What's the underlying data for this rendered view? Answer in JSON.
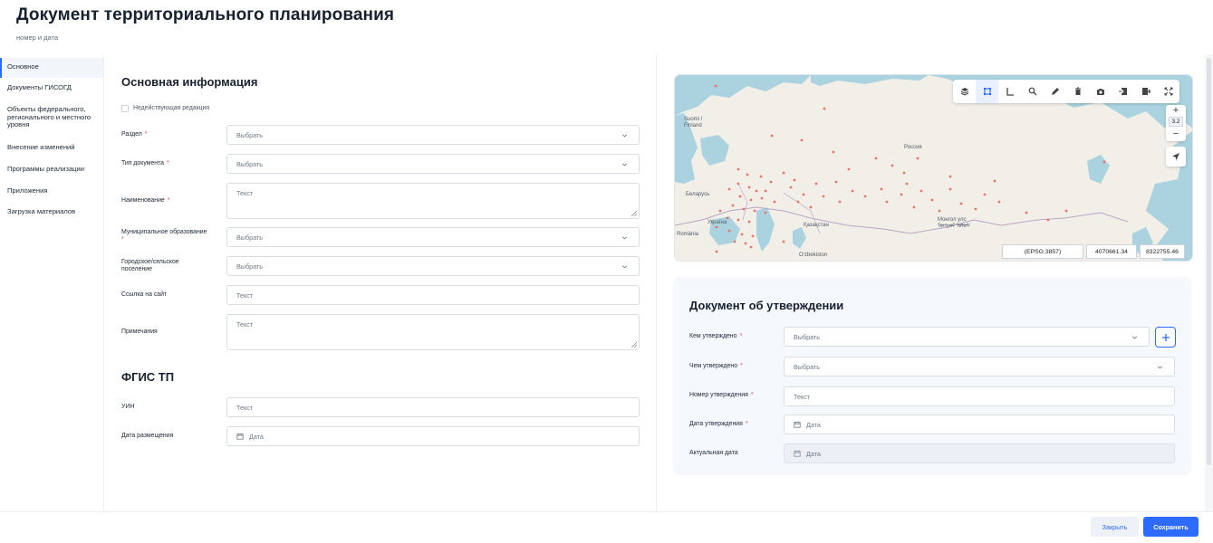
{
  "header": {
    "title": "Документ территориального планирования",
    "subtitle": "номер и дата"
  },
  "sidebar": {
    "items": [
      {
        "label": "Основное",
        "active": true
      },
      {
        "label": "Документы ГИСОГД",
        "active": false
      },
      {
        "label": "Объекты федерального, регионального и местного уровня",
        "active": false
      },
      {
        "label": "Внесение изменений",
        "active": false
      },
      {
        "label": "Программы реализации",
        "active": false
      },
      {
        "label": "Приложения",
        "active": false
      },
      {
        "label": "Загрузка материалов",
        "active": false
      }
    ]
  },
  "main_info": {
    "title": "Основная информация",
    "inactive_checkbox_label": "Недействующая редакция",
    "fields": {
      "section": {
        "label": "Раздел",
        "placeholder": "Выбрать"
      },
      "doc_type": {
        "label": "Тип документа",
        "placeholder": "Выбрать"
      },
      "name": {
        "label": "Наименование",
        "placeholder": "Текст"
      },
      "municipality": {
        "label": "Муниципальное образование",
        "placeholder": "Выбрать"
      },
      "settlement": {
        "label": "Городское/сельское поселение",
        "placeholder": "Выбрать"
      },
      "site_link": {
        "label": "Ссылка на сайт",
        "placeholder": "Текст"
      },
      "notes": {
        "label": "Примечания",
        "placeholder": "Текст"
      }
    }
  },
  "fgis": {
    "title": "ФГИС ТП",
    "uin": {
      "label": "УИН",
      "placeholder": "Текст"
    },
    "publish_date": {
      "label": "Дата размещения",
      "placeholder": "Дата"
    }
  },
  "map": {
    "zoom_level": "3.2",
    "zoom_in": "+",
    "zoom_out": "−",
    "projection": "(EPSG:3857)",
    "coord_x": "4070661.34",
    "coord_y": "8322755.46",
    "labels": {
      "finland": "Suomi / Finland",
      "russia": "Россия",
      "belarus": "Беларусь",
      "ukraine": "Україна",
      "romania": "România",
      "kazakhstan": "Қазақстан",
      "mongolia": "Монгол улс ᠮᠣᠩᠭᠣᠯ ᠤᠯᠤᠰ",
      "uzbekistan": "O‘zbekiston"
    },
    "tools": [
      "layers-icon",
      "select-area-icon",
      "measure-icon",
      "search-icon",
      "draw-icon",
      "delete-icon",
      "screenshot-icon",
      "import-icon",
      "export-icon",
      "fullscreen-icon"
    ]
  },
  "approval": {
    "title": "Документ об утверждении",
    "approved_by": {
      "label": "Кем утверждено",
      "placeholder": "Выбрать"
    },
    "approved_with": {
      "label": "Чем утверждено",
      "placeholder": "Выбрать"
    },
    "approval_number": {
      "label": "Номер утверждения",
      "placeholder": "Текст"
    },
    "approval_date": {
      "label": "Дата утверждения",
      "placeholder": "Дата"
    },
    "actual_date": {
      "label": "Актуальная дата",
      "placeholder": "Дата"
    }
  },
  "footer": {
    "close_label": "Закрыть",
    "save_label": "Сохранить"
  },
  "colors": {
    "accent": "#2d6bff",
    "required": "#e5484d",
    "map_water": "#aad3df",
    "map_land": "#f2efe9",
    "map_point": "#e8736a"
  }
}
